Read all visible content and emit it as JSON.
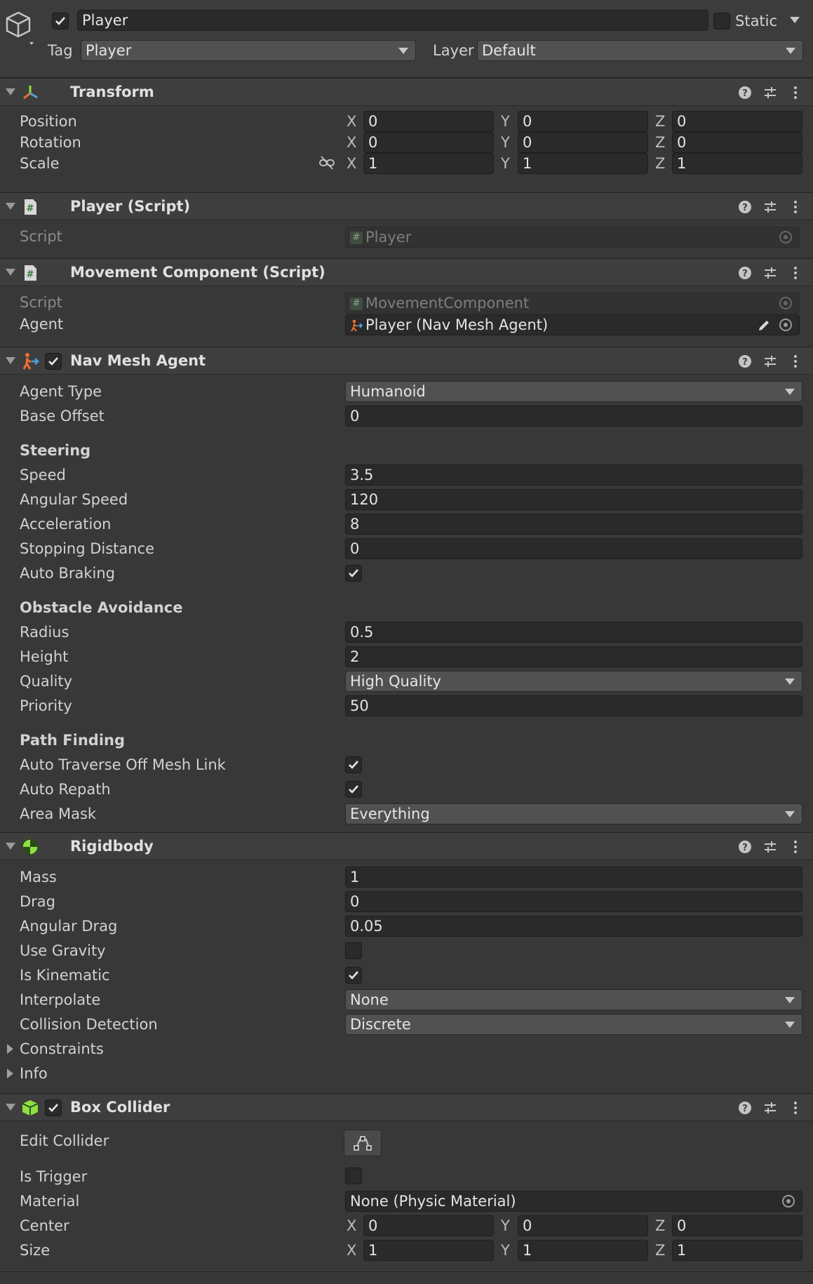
{
  "header": {
    "name": "Player",
    "active": true,
    "static_label": "Static",
    "static": false,
    "tag_label": "Tag",
    "tag_value": "Player",
    "layer_label": "Layer",
    "layer_value": "Default"
  },
  "transform": {
    "title": "Transform",
    "position_label": "Position",
    "rotation_label": "Rotation",
    "scale_label": "Scale",
    "position": {
      "x": "0",
      "y": "0",
      "z": "0"
    },
    "rotation": {
      "x": "0",
      "y": "0",
      "z": "0"
    },
    "scale": {
      "x": "1",
      "y": "1",
      "z": "1"
    },
    "axis_x": "X",
    "axis_y": "Y",
    "axis_z": "Z"
  },
  "player_script": {
    "title": "Player (Script)",
    "script_label": "Script",
    "script_value": "Player"
  },
  "movement_script": {
    "title": "Movement Component (Script)",
    "script_label": "Script",
    "script_value": "MovementComponent",
    "agent_label": "Agent",
    "agent_value": "Player (Nav Mesh Agent)"
  },
  "nav_mesh_agent": {
    "title": "Nav Mesh Agent",
    "enabled": true,
    "agent_type_label": "Agent Type",
    "agent_type_value": "Humanoid",
    "base_offset_label": "Base Offset",
    "base_offset_value": "0",
    "steering_label": "Steering",
    "speed_label": "Speed",
    "speed_value": "3.5",
    "angular_speed_label": "Angular Speed",
    "angular_speed_value": "120",
    "acceleration_label": "Acceleration",
    "acceleration_value": "8",
    "stopping_distance_label": "Stopping Distance",
    "stopping_distance_value": "0",
    "auto_braking_label": "Auto Braking",
    "auto_braking": true,
    "obstacle_avoidance_label": "Obstacle Avoidance",
    "radius_label": "Radius",
    "radius_value": "0.5",
    "height_label": "Height",
    "height_value": "2",
    "quality_label": "Quality",
    "quality_value": "High Quality",
    "priority_label": "Priority",
    "priority_value": "50",
    "path_finding_label": "Path Finding",
    "auto_traverse_label": "Auto Traverse Off Mesh Link",
    "auto_traverse": true,
    "auto_repath_label": "Auto Repath",
    "auto_repath": true,
    "area_mask_label": "Area Mask",
    "area_mask_value": "Everything"
  },
  "rigidbody": {
    "title": "Rigidbody",
    "mass_label": "Mass",
    "mass_value": "1",
    "drag_label": "Drag",
    "drag_value": "0",
    "angular_drag_label": "Angular Drag",
    "angular_drag_value": "0.05",
    "use_gravity_label": "Use Gravity",
    "use_gravity": false,
    "is_kinematic_label": "Is Kinematic",
    "is_kinematic": true,
    "interpolate_label": "Interpolate",
    "interpolate_value": "None",
    "collision_detection_label": "Collision Detection",
    "collision_detection_value": "Discrete",
    "constraints_label": "Constraints",
    "info_label": "Info"
  },
  "box_collider": {
    "title": "Box Collider",
    "enabled": true,
    "edit_collider_label": "Edit Collider",
    "is_trigger_label": "Is Trigger",
    "is_trigger": false,
    "material_label": "Material",
    "material_value": "None (Physic Material)",
    "center_label": "Center",
    "size_label": "Size",
    "center": {
      "x": "0",
      "y": "0",
      "z": "0"
    },
    "size": {
      "x": "1",
      "y": "1",
      "z": "1"
    }
  },
  "colors": {
    "background": "#383838",
    "field": "#2a2a2a",
    "dropdown": "#515151",
    "transform_icon": "#4fa3e0",
    "nav_icon": "#f07030",
    "rigidbody_icon": "#8fe040",
    "collider_icon": "#8fe040"
  },
  "icons": {
    "gameobject": "cube-icon",
    "help": "help-icon",
    "presets": "sliders-icon",
    "menu": "kebab-menu-icon",
    "scale_link": "unlink-icon",
    "edit": "pencil-icon"
  }
}
